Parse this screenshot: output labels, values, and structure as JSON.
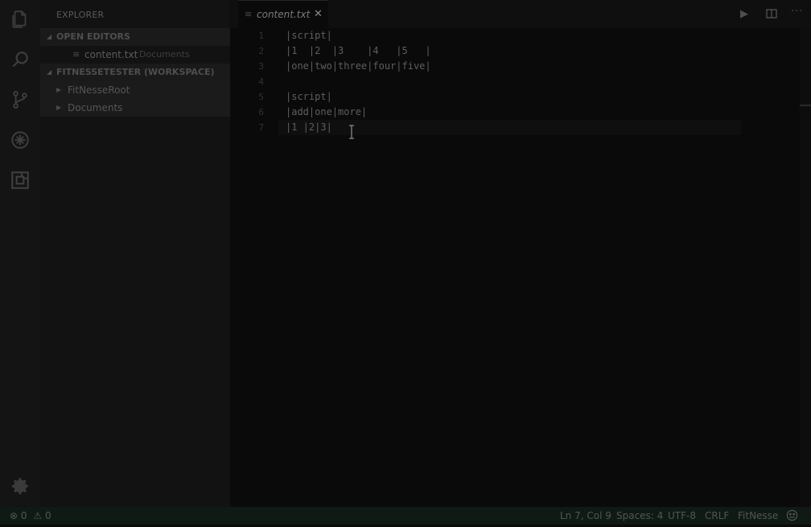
{
  "activity_bar": {
    "icons": [
      "files-icon",
      "search-icon",
      "source-control-icon",
      "debug-icon",
      "extensions-icon"
    ],
    "settings_icon": "gear-icon"
  },
  "sidebar": {
    "title": "EXPLORER",
    "open_editors_header": "OPEN EDITORS",
    "open_editors": [
      {
        "name": "content.txt",
        "folder": "Documents"
      }
    ],
    "workspace_header": "FITNESSETESTER (WORKSPACE)",
    "workspace_items": [
      {
        "label": "FitNesseRoot"
      },
      {
        "label": "Documents"
      }
    ]
  },
  "tabs": [
    {
      "label": "content.txt",
      "close": "✕"
    }
  ],
  "toolbar": {
    "run_icon": "▶",
    "split_icon": "split-editor-icon",
    "more_icon": "···"
  },
  "editor": {
    "line_numbers": [
      "1",
      "2",
      "3",
      "4",
      "5",
      "6",
      "7"
    ],
    "lines": [
      "|script|",
      "|1  |2  |3    |4   |5   |",
      "|one|two|three|four|five|",
      "",
      "|script|",
      "|add|one|more|",
      "|1 |2|3|"
    ]
  },
  "status_bar": {
    "errors": "0",
    "warnings": "0",
    "cursor_position": "Ln 7, Col 9",
    "indentation": "Spaces: 4",
    "encoding": "UTF-8",
    "line_ending": "CRLF",
    "language": "FitNesse",
    "feedback_icon": "smiley-icon"
  },
  "colors": {
    "background": "#0a0a0a",
    "sidebar": "#121212",
    "activity_bar": "#141414",
    "status_bar": "#0f1a14"
  }
}
